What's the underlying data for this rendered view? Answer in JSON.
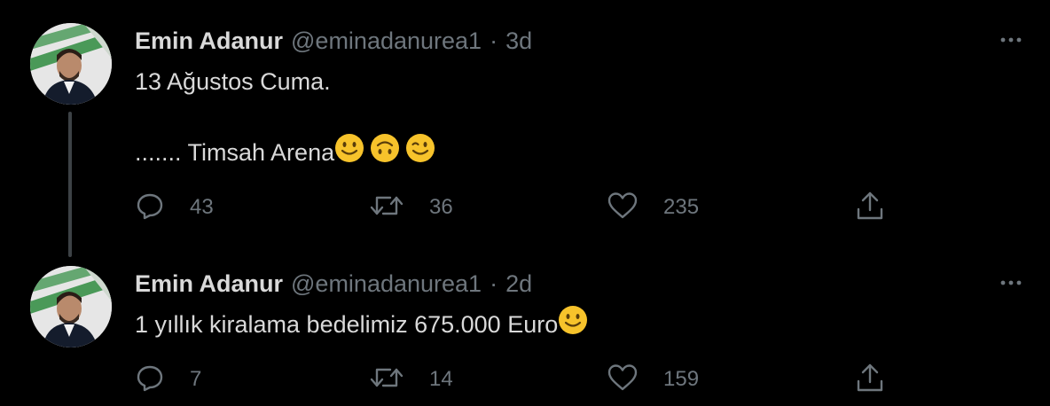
{
  "tweets": [
    {
      "author": {
        "display_name": "Emin Adanur",
        "handle": "@eminadanurea1",
        "avatar_icon": "profile-photo"
      },
      "separator": "·",
      "timestamp": "3d",
      "lines": [
        "13 Ağustos Cuma.",
        "....... Timsah Arena"
      ],
      "emojis": [
        "slightly-smiling-face",
        "upside-down-face",
        "winking-face"
      ],
      "stats": {
        "replies": "43",
        "retweets": "36",
        "likes": "235"
      }
    },
    {
      "author": {
        "display_name": "Emin Adanur",
        "handle": "@eminadanurea1",
        "avatar_icon": "profile-photo"
      },
      "separator": "·",
      "timestamp": "2d",
      "lines": [
        "1 yıllık kiralama bedelimiz 675.000 Euro"
      ],
      "emojis": [
        "slightly-smiling-face"
      ],
      "stats": {
        "replies": "7",
        "retweets": "14",
        "likes": "159"
      }
    }
  ],
  "colors": {
    "background": "#000000",
    "text_primary": "#d9d9d9",
    "text_secondary": "#6e767d",
    "thread_line": "#3d4246",
    "emoji_yellow": "#f7c32b"
  },
  "icons": {
    "more": "more-horizontal-icon",
    "reply": "reply-icon",
    "retweet": "retweet-icon",
    "like": "like-icon",
    "share": "share-icon"
  }
}
